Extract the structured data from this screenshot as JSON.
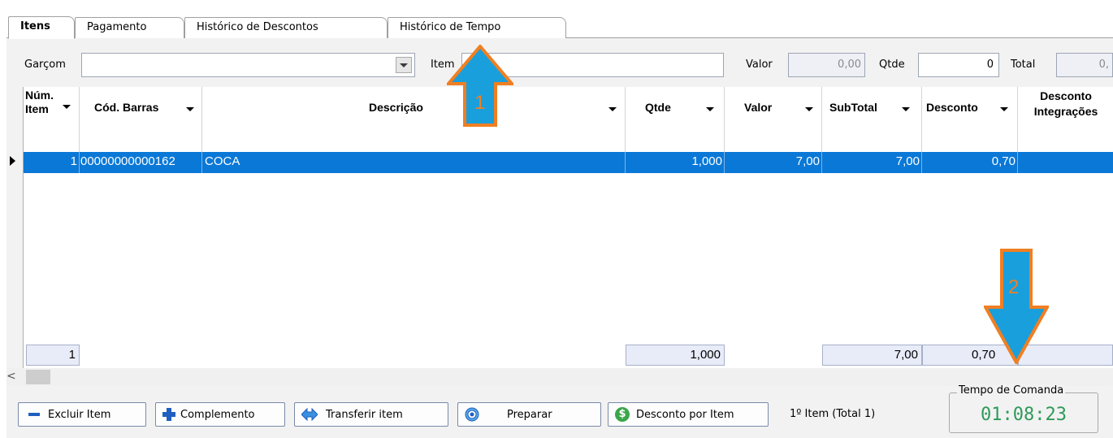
{
  "tabs": [
    {
      "label": "Itens",
      "active": true
    },
    {
      "label": "Pagamento"
    },
    {
      "label": "Histórico de Descontos"
    },
    {
      "label": "Histórico de Tempo"
    }
  ],
  "filters": {
    "garcom_label": "Garçom",
    "garcom_value": "",
    "item_label": "Item",
    "item_value": "",
    "valor_label": "Valor",
    "valor_value": "0,00",
    "qtde_label": "Qtde",
    "qtde_value": "0",
    "total_label": "Total",
    "total_value": "0,"
  },
  "grid": {
    "columns": [
      {
        "label": "Núm. Item"
      },
      {
        "label": "Cód. Barras"
      },
      {
        "label": "Descrição"
      },
      {
        "label": "Qtde"
      },
      {
        "label": "Valor"
      },
      {
        "label": "SubTotal"
      },
      {
        "label": "Desconto"
      },
      {
        "label": "Desconto Integrações"
      }
    ],
    "rows": [
      {
        "num": "1",
        "barcode": "00000000000162",
        "desc": "COCA",
        "qtde": "1,000",
        "valor": "7,00",
        "subtotal": "7,00",
        "desconto": "0,70",
        "desc_integ": ""
      }
    ],
    "totals": {
      "num": "1",
      "qtde": "1,000",
      "subtotal": "7,00",
      "desconto": "0,70"
    }
  },
  "scroll_left": "<",
  "buttons": {
    "excluir": "Excluir Item",
    "complemento": "Complemento",
    "transferir": "Transferir item",
    "preparar": "Preparar",
    "desconto": "Desconto por Item"
  },
  "item_status": "1º Item (Total 1)",
  "tempo": {
    "title": "Tempo de Comanda",
    "value": "01:08:23"
  },
  "annotations": {
    "arrow1": "1",
    "arrow2": "2"
  },
  "colors": {
    "selection": "#0a78d7",
    "timer": "#2e9a5a",
    "arrow_fill": "#199fdc",
    "arrow_stroke": "#f07f22"
  }
}
